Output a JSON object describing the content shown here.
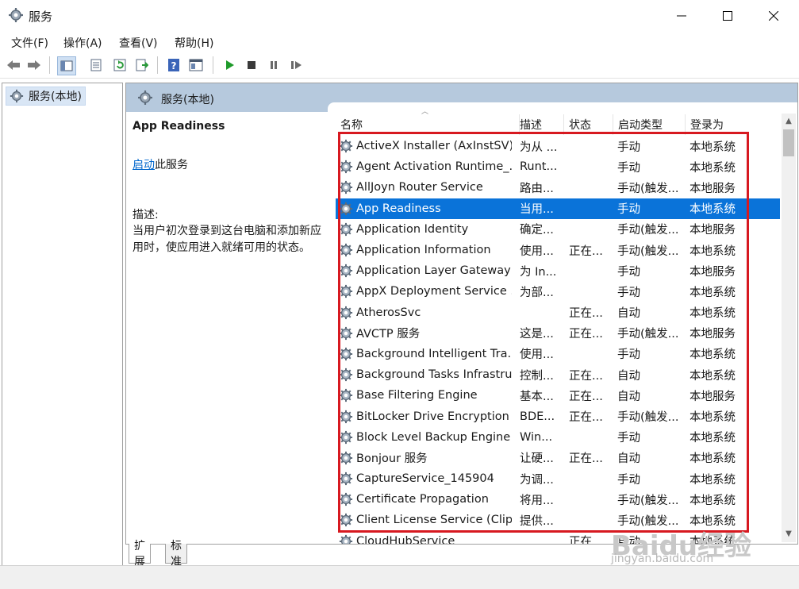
{
  "window": {
    "title": "服务",
    "minimize": "—",
    "maximize": "☐",
    "close": "✕"
  },
  "menu": [
    "文件(F)",
    "操作(A)",
    "查看(V)",
    "帮助(H)"
  ],
  "toolbar": {
    "icons": [
      "back-icon",
      "forward-icon",
      "show-hide-tree-icon",
      "properties-icon",
      "refresh-icon",
      "export-list-icon",
      "help-icon",
      "console-icon",
      "start-service-icon",
      "stop-service-icon",
      "pause-service-icon",
      "restart-service-icon"
    ]
  },
  "tree": {
    "root": "服务(本地)"
  },
  "pane": {
    "header": "服务(本地)",
    "selected_title": "App Readiness",
    "action_link": "启动",
    "action_suffix": "此服务",
    "desc_label": "描述:",
    "desc_text": "当用户初次登录到这台电脑和添加新应用时，使应用进入就绪可用的状态。"
  },
  "columns": [
    "名称",
    "描述",
    "状态",
    "启动类型",
    "登录为"
  ],
  "rows": [
    {
      "name": "ActiveX Installer (AxInstSV)",
      "desc": "为从 ...",
      "status": "",
      "start": "手动",
      "logon": "本地系统"
    },
    {
      "name": "Agent Activation Runtime_...",
      "desc": "Runt...",
      "status": "",
      "start": "手动",
      "logon": "本地系统"
    },
    {
      "name": "AllJoyn Router Service",
      "desc": "路由...",
      "status": "",
      "start": "手动(触发...",
      "logon": "本地服务"
    },
    {
      "name": "App Readiness",
      "desc": "当用...",
      "status": "",
      "start": "手动",
      "logon": "本地系统",
      "selected": true
    },
    {
      "name": "Application Identity",
      "desc": "确定...",
      "status": "",
      "start": "手动(触发...",
      "logon": "本地服务"
    },
    {
      "name": "Application Information",
      "desc": "使用...",
      "status": "正在...",
      "start": "手动(触发...",
      "logon": "本地系统"
    },
    {
      "name": "Application Layer Gateway ...",
      "desc": "为 In...",
      "status": "",
      "start": "手动",
      "logon": "本地服务"
    },
    {
      "name": "AppX Deployment Service ...",
      "desc": "为部...",
      "status": "",
      "start": "手动",
      "logon": "本地系统"
    },
    {
      "name": "AtherosSvc",
      "desc": "",
      "status": "正在...",
      "start": "自动",
      "logon": "本地系统"
    },
    {
      "name": "AVCTP 服务",
      "desc": "这是...",
      "status": "正在...",
      "start": "手动(触发...",
      "logon": "本地服务"
    },
    {
      "name": "Background Intelligent Tra...",
      "desc": "使用...",
      "status": "",
      "start": "手动",
      "logon": "本地系统"
    },
    {
      "name": "Background Tasks Infrastru...",
      "desc": "控制...",
      "status": "正在...",
      "start": "自动",
      "logon": "本地系统"
    },
    {
      "name": "Base Filtering Engine",
      "desc": "基本...",
      "status": "正在...",
      "start": "自动",
      "logon": "本地服务"
    },
    {
      "name": "BitLocker Drive Encryption ...",
      "desc": "BDE...",
      "status": "正在...",
      "start": "手动(触发...",
      "logon": "本地系统"
    },
    {
      "name": "Block Level Backup Engine ...",
      "desc": "Win...",
      "status": "",
      "start": "手动",
      "logon": "本地系统"
    },
    {
      "name": "Bonjour 服务",
      "desc": "让硬...",
      "status": "正在...",
      "start": "自动",
      "logon": "本地系统"
    },
    {
      "name": "CaptureService_145904",
      "desc": "为调...",
      "status": "",
      "start": "手动",
      "logon": "本地系统"
    },
    {
      "name": "Certificate Propagation",
      "desc": "将用...",
      "status": "",
      "start": "手动(触发...",
      "logon": "本地系统"
    },
    {
      "name": "Client License Service (Clip...",
      "desc": "提供...",
      "status": "",
      "start": "手动(触发...",
      "logon": "本地系统"
    },
    {
      "name": "CloudHubService",
      "desc": "",
      "status": "正在...",
      "start": "自动",
      "logon": "本地系统"
    }
  ],
  "tabs": [
    "扩展",
    "标准"
  ],
  "watermark": {
    "main": "Baidu经验",
    "sub": "jingyan.baidu.com"
  },
  "colors": {
    "selection": "#0a73d9",
    "highlight": "#d71920",
    "header_band": "#b6c9dd",
    "link": "#0066cc"
  }
}
